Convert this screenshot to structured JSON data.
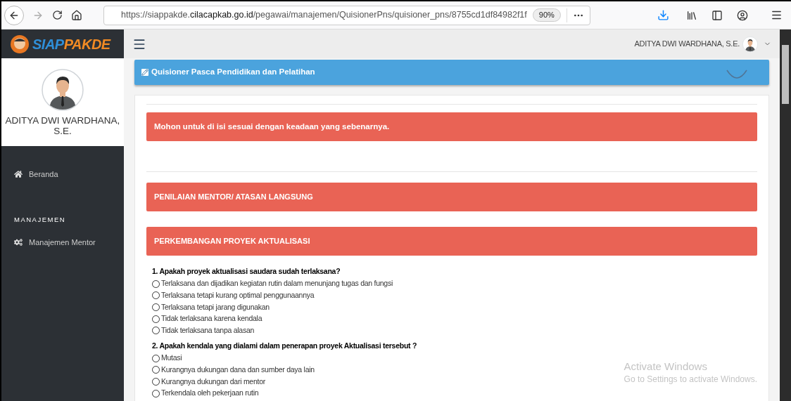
{
  "browser": {
    "url_prefix": "https://siappakde.",
    "url_domain": "cilacapkab.go.id",
    "url_path": "/pegawai/manajemen/QuisionerPns/quisioner_pns/8755cd1df84982f1f",
    "zoom": "90%"
  },
  "app": {
    "logo_part_1": "SIAP",
    "logo_part_2": "PAKDE",
    "user_name": "ADITYA DWI WARDHANA, S.E."
  },
  "sidebar": {
    "profile_name": "ADITYA DWI WARDHANA, S.E.",
    "sections": [
      {
        "items": [
          {
            "label": "Beranda",
            "kind": "home"
          }
        ]
      },
      {
        "heading": "MANAJEMEN",
        "items": [
          {
            "label": "Manajemen Mentor",
            "kind": "gears"
          }
        ]
      }
    ]
  },
  "page_header": {
    "title": "Quisioner Pasca Pendidikan dan Pelatihan"
  },
  "notice": "Mohon untuk di isi sesuai dengan keadaan yang sebenarnya.",
  "sections": [
    "PENILAIAN MENTOR/ ATASAN LANGSUNG",
    "PERKEMBANGAN PROYEK AKTUALISASI"
  ],
  "questions": [
    {
      "text": "1. Apakah proyek aktualisasi saudara sudah terlaksana?",
      "options": [
        {
          "label": "Terlaksana dan dijadikan kegiatan rutin dalam menunjang tugas dan fungsi",
          "selected": false
        },
        {
          "label": "Terlaksana tetapi kurang optimal penggunaannya",
          "selected": false
        },
        {
          "label": "Terlaksana tetapi jarang digunakan",
          "selected": false
        },
        {
          "label": "Tidak terlaksana karena kendala",
          "selected": false
        },
        {
          "label": "Tidak terlaksana tanpa alasan",
          "selected": false
        }
      ]
    },
    {
      "text": "2. Apakah kendala yang dialami dalam penerapan proyek Aktualisasi tersebut ?",
      "options": [
        {
          "label": "Mutasi",
          "selected": false
        },
        {
          "label": "Kurangnya dukungan dana dan sumber daya lain",
          "selected": false
        },
        {
          "label": "Kurangnya dukungan dari mentor",
          "selected": false
        },
        {
          "label": "Terkendala oleh pekerjaan rutin",
          "selected": false
        }
      ]
    }
  ],
  "os_overlay": {
    "title": "Activate Windows",
    "subtitle": "Go to Settings to activate Windows."
  }
}
